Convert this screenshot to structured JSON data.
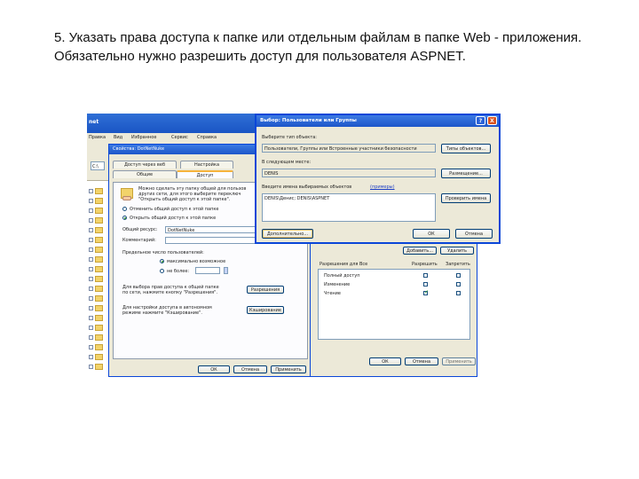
{
  "slide": {
    "text": "5. Указать права доступа к папке или отдельным файлам в папке Web - приложения. Обязательно нужно разрешить доступ для пользователя ASPNET."
  },
  "explorer": {
    "title": "net",
    "menu": [
      "Правка",
      "Вид",
      "Избранное",
      "Сервис",
      "Справка"
    ],
    "folder_label": "C:\\"
  },
  "properties": {
    "title": "Свойства: DotNetNuke",
    "tabs": [
      "Доступ через веб",
      "Настройка",
      "Общие",
      "Доступ"
    ],
    "intro": [
      "Можно сделать эту папку общей для пользов",
      "других сети, для этого выберите переключ",
      "\"Открыть общий доступ к этой папке\"."
    ],
    "radio_no_share": "Отменить общий доступ к этой папке",
    "radio_share": "Открыть общий доступ к этой папке",
    "share_name_label": "Общий ресурс:",
    "share_name_value": "DotNetNuke",
    "comment_label": "Комментарий:",
    "limit_label": "Предельное число пользователей:",
    "radio_max": "максимально возможное",
    "radio_max_n": "не более:",
    "perm_text": [
      "Для выбора прав доступа к общей папке",
      "по сети, нажмите кнопку \"Разрешения\"."
    ],
    "perm_button": "Разрешения",
    "cache_text": [
      "Для настройки доступа в автономном",
      "режиме нажмите \"Кэширование\"."
    ],
    "cache_button": "Кэширование",
    "ok": "ОК",
    "cancel": "Отмена",
    "apply": "Применить"
  },
  "permissions": {
    "add": "Добавить...",
    "remove": "Удалить",
    "header_label": "Разрешения для Все",
    "col_allow": "Разрешить",
    "col_deny": "Запретить",
    "rows": [
      {
        "label": "Полный доступ",
        "allow": false,
        "deny": false
      },
      {
        "label": "Изменение",
        "allow": false,
        "deny": false
      },
      {
        "label": "Чтение",
        "allow": true,
        "deny": false
      }
    ],
    "ok": "ОК",
    "cancel": "Отмена",
    "apply": "Применить"
  },
  "select": {
    "title": "Выбор: Пользователи или Группы",
    "help": "?",
    "close": "X",
    "types_label": "Выберите тип объекта:",
    "types_value": "Пользователи, Группы или Встроенные участники безопасности",
    "types_button": "Типы объектов...",
    "location_label": "В следующем месте:",
    "location_value": "DENIS",
    "location_button": "Размещение...",
    "names_label": "Введите имена выбираемых объектов",
    "names_link": "(примеры)",
    "names_value": "DENIS\\Денис; DENIS\\ASPNET",
    "check_button": "Проверить имена",
    "advanced_button": "Дополнительно...",
    "ok": "ОК",
    "cancel": "Отмена"
  }
}
